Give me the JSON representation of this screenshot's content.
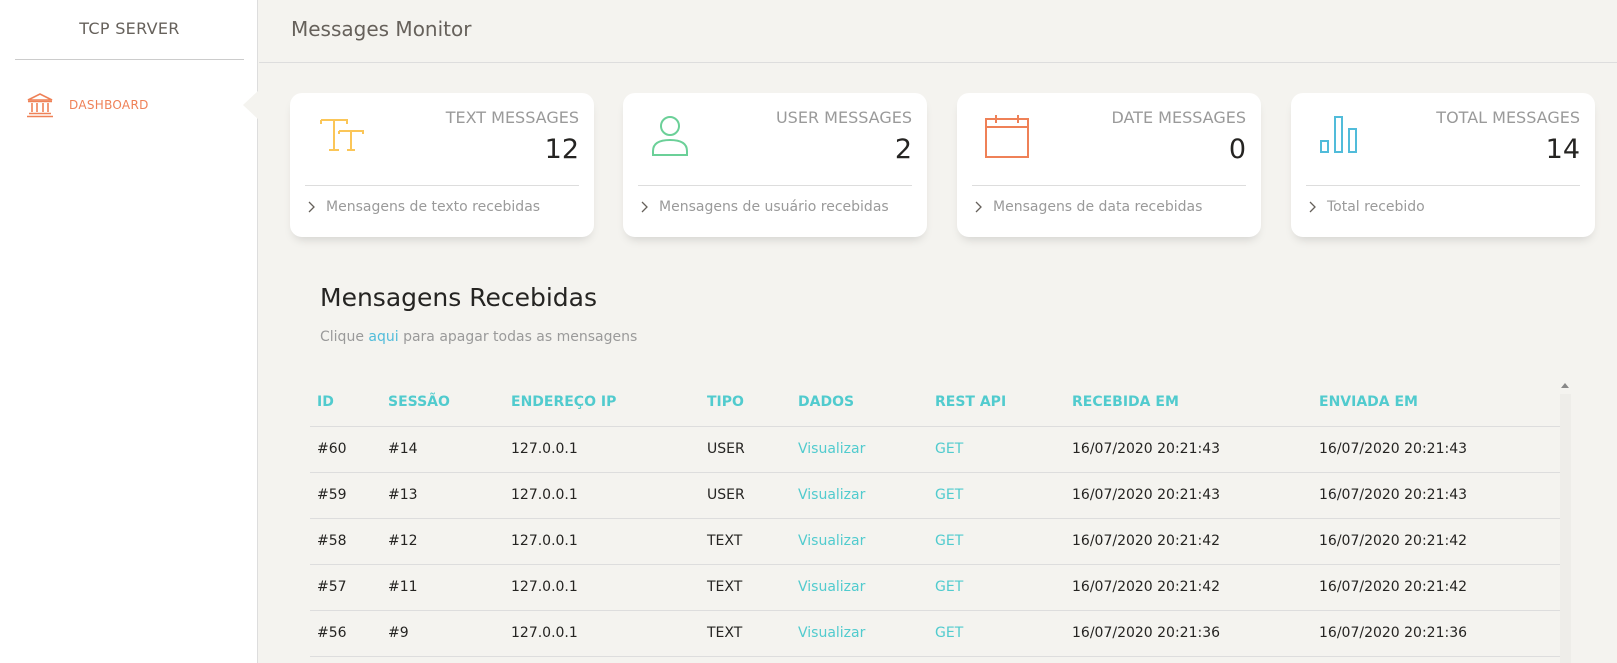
{
  "sidebar": {
    "logo": "TCP SERVER",
    "items": [
      {
        "label": "DASHBOARD",
        "icon": "bank-icon",
        "active": true
      }
    ]
  },
  "navbar": {
    "title": "Messages Monitor"
  },
  "colors": {
    "accent": "#51cbce",
    "active_nav": "#ef8157",
    "text_icon": "#fbc658",
    "user_icon": "#6bd098",
    "date_icon": "#ef8157",
    "total_icon": "#51bcda"
  },
  "cards": [
    {
      "category": "TEXT MESSAGES",
      "value": "12",
      "footer": "Mensagens de texto recebidas",
      "icon": "text-format-icon"
    },
    {
      "category": "USER MESSAGES",
      "value": "2",
      "footer": "Mensagens de usuário recebidas",
      "icon": "user-icon"
    },
    {
      "category": "DATE MESSAGES",
      "value": "0",
      "footer": "Mensagens de data recebidas",
      "icon": "calendar-icon"
    },
    {
      "category": "TOTAL MESSAGES",
      "value": "14",
      "footer": "Total recebido",
      "icon": "bar-chart-icon"
    }
  ],
  "messages": {
    "title": "Mensagens Recebidas",
    "subtitle_before": "Clique",
    "subtitle_link": "aqui",
    "subtitle_after": "para apagar todas as mensagens",
    "columns": [
      "ID",
      "SESSÃO",
      "ENDEREÇO IP",
      "TIPO",
      "DADOS",
      "REST API",
      "RECEBIDA EM",
      "ENVIADA EM"
    ],
    "rows": [
      {
        "id": "#60",
        "session": "#14",
        "ip": "127.0.0.1",
        "type": "USER",
        "data": "Visualizar",
        "api": "GET",
        "received": "16/07/2020 20:21:43",
        "sent": "16/07/2020 20:21:43"
      },
      {
        "id": "#59",
        "session": "#13",
        "ip": "127.0.0.1",
        "type": "USER",
        "data": "Visualizar",
        "api": "GET",
        "received": "16/07/2020 20:21:43",
        "sent": "16/07/2020 20:21:43"
      },
      {
        "id": "#58",
        "session": "#12",
        "ip": "127.0.0.1",
        "type": "TEXT",
        "data": "Visualizar",
        "api": "GET",
        "received": "16/07/2020 20:21:42",
        "sent": "16/07/2020 20:21:42"
      },
      {
        "id": "#57",
        "session": "#11",
        "ip": "127.0.0.1",
        "type": "TEXT",
        "data": "Visualizar",
        "api": "GET",
        "received": "16/07/2020 20:21:42",
        "sent": "16/07/2020 20:21:42"
      },
      {
        "id": "#56",
        "session": "#9",
        "ip": "127.0.0.1",
        "type": "TEXT",
        "data": "Visualizar",
        "api": "GET",
        "received": "16/07/2020 20:21:36",
        "sent": "16/07/2020 20:21:36"
      }
    ]
  }
}
